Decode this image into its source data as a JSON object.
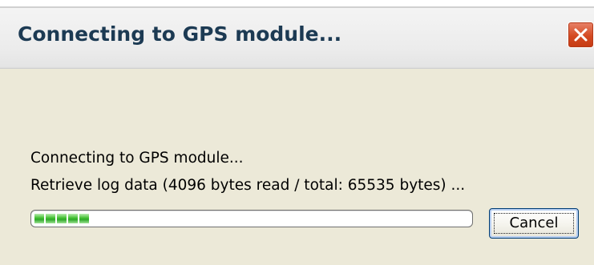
{
  "window": {
    "title": "Connecting to GPS module..."
  },
  "status": {
    "line1": "Connecting to GPS module...",
    "line2": "Retrieve log data (4096 bytes read / total: 65535 bytes) ..."
  },
  "progress": {
    "fraction": 0.0625,
    "blocks_filled": 5,
    "fill_color": "#3fbf2f"
  },
  "buttons": {
    "cancel_label": "Cancel"
  },
  "icons": {
    "close": "close-icon"
  },
  "colors": {
    "window_bg": "#ece9d8",
    "title_text": "#1c3a53",
    "close_red": "#d44a22"
  }
}
